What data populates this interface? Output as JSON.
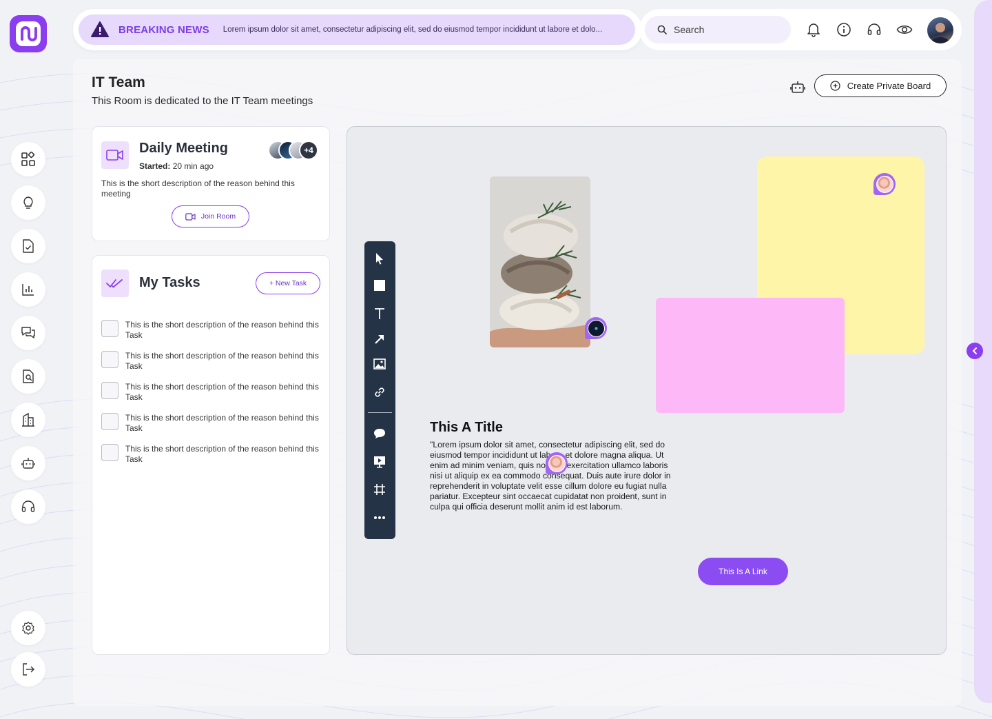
{
  "header": {
    "news_label": "BREAKING NEWS",
    "news_text": "Lorem ipsum dolor sit amet, consectetur adipiscing elit, sed do eiusmod tempor incididunt ut labore et dolo...",
    "search_placeholder": "Search",
    "icons": [
      "bell-icon",
      "info-icon",
      "headset-icon",
      "eye-icon"
    ]
  },
  "sidebar": {
    "items": [
      "dashboard-icon",
      "lightbulb-icon",
      "document-check-icon",
      "chart-icon",
      "chat-icon",
      "file-search-icon",
      "building-icon",
      "bot-icon",
      "headset-icon"
    ],
    "bottom": [
      "settings-icon",
      "logout-icon"
    ]
  },
  "room": {
    "title": "IT Team",
    "subtitle": "This Room is dedicated to the IT Team meetings",
    "create_board_label": "Create Private Board"
  },
  "meeting": {
    "title": "Daily Meeting",
    "started_label": "Started:",
    "started_value": "20 min ago",
    "description": "This is the short description of the reason behind this meeting",
    "extra_participants": "+4",
    "join_label": "Join Room"
  },
  "tasks": {
    "title": "My Tasks",
    "new_task_label": "+ New Task",
    "items": [
      {
        "text": "This is the short description of the reason behind this Task",
        "checked": false
      },
      {
        "text": "This is the short description of the reason behind this Task",
        "checked": false
      },
      {
        "text": "This is the short description of the reason behind this Task",
        "checked": false
      },
      {
        "text": "This is the short description of the reason behind this Task",
        "checked": false
      },
      {
        "text": "This is the short description of the reason behind this Task",
        "checked": false
      }
    ]
  },
  "board": {
    "tools": [
      "pointer-icon",
      "rectangle-icon",
      "text-icon",
      "arrow-icon",
      "image-icon",
      "link-icon",
      "comment-icon",
      "present-icon",
      "frame-icon",
      "more-icon"
    ],
    "text_title": "This A Title",
    "text_body": "\"Lorem ipsum dolor sit amet, consectetur adipiscing elit, sed do eiusmod tempor incididunt ut labore et dolore magna aliqua. Ut enim ad minim veniam, quis nostrud exercitation ullamco laboris nisi ut aliquip ex ea commodo consequat. Duis aute irure dolor in reprehenderit in voluptate velit esse cillum dolore eu fugiat nulla pariatur. Excepteur sint occaecat cupidatat non proident, sunt in culpa qui officia deserunt mollit anim id est laborum.",
    "link_label": "This Is A Link",
    "colors": {
      "sticky_yellow": "#fff5a8",
      "sticky_pink": "#fdb9f7",
      "accent": "#8b3df0"
    }
  }
}
